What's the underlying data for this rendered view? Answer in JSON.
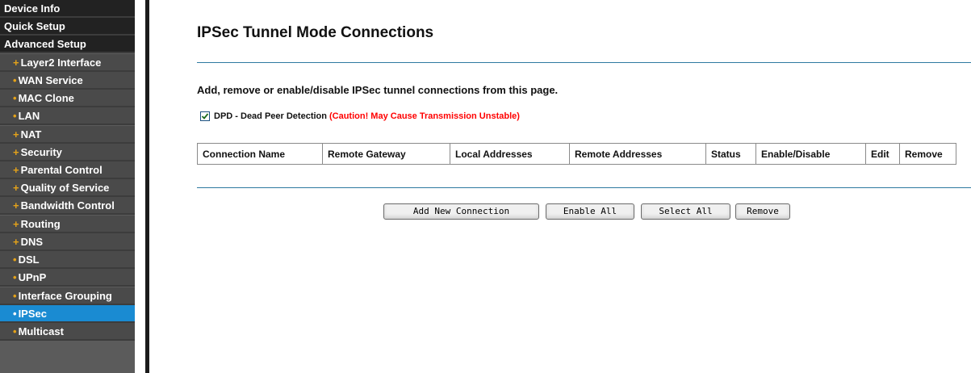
{
  "sidebar": {
    "items": [
      {
        "label": "Device Info",
        "bullet": "",
        "level": "top"
      },
      {
        "label": "Quick Setup",
        "bullet": "",
        "level": "top"
      },
      {
        "label": "Advanced Setup",
        "bullet": "",
        "level": "top"
      },
      {
        "label": "Layer2 Interface",
        "bullet": "+",
        "level": "sub"
      },
      {
        "label": "WAN Service",
        "bullet": "•",
        "level": "sub"
      },
      {
        "label": "MAC Clone",
        "bullet": "•",
        "level": "sub"
      },
      {
        "label": "LAN",
        "bullet": "•",
        "level": "sub"
      },
      {
        "label": "NAT",
        "bullet": "+",
        "level": "sub"
      },
      {
        "label": "Security",
        "bullet": "+",
        "level": "sub"
      },
      {
        "label": "Parental Control",
        "bullet": "+",
        "level": "sub"
      },
      {
        "label": "Quality of Service",
        "bullet": "+",
        "level": "sub"
      },
      {
        "label": "Bandwidth Control",
        "bullet": "+",
        "level": "sub"
      },
      {
        "label": "Routing",
        "bullet": "+",
        "level": "sub"
      },
      {
        "label": "DNS",
        "bullet": "+",
        "level": "sub"
      },
      {
        "label": "DSL",
        "bullet": "•",
        "level": "sub"
      },
      {
        "label": "UPnP",
        "bullet": "•",
        "level": "sub"
      },
      {
        "label": "Interface Grouping",
        "bullet": "•",
        "level": "sub"
      },
      {
        "label": "IPSec",
        "bullet": "•",
        "level": "sub",
        "active": true
      },
      {
        "label": "Multicast",
        "bullet": "•",
        "level": "sub"
      }
    ]
  },
  "main": {
    "title": "IPSec Tunnel Mode Connections",
    "intro": "Add, remove or enable/disable IPSec tunnel connections from this page.",
    "dpd": {
      "checked": true,
      "label": "DPD - Dead Peer Detection",
      "warning": "(Caution! May Cause Transmission Unstable)"
    },
    "table": {
      "columns": [
        "Connection Name",
        "Remote Gateway",
        "Local Addresses",
        "Remote Addresses",
        "Status",
        "Enable/Disable",
        "Edit",
        "Remove"
      ],
      "rows": []
    },
    "buttons": {
      "add": "Add New Connection",
      "enable_all": "Enable All",
      "select_all": "Select All",
      "remove": "Remove"
    }
  },
  "colors": {
    "sidebar_top": "#222222",
    "sidebar_sub": "#4a4a4a",
    "sidebar_active": "#1a8bd2",
    "bullet": "#e4a21a",
    "rule": "#2e7aa0",
    "warning": "#ff0000"
  }
}
